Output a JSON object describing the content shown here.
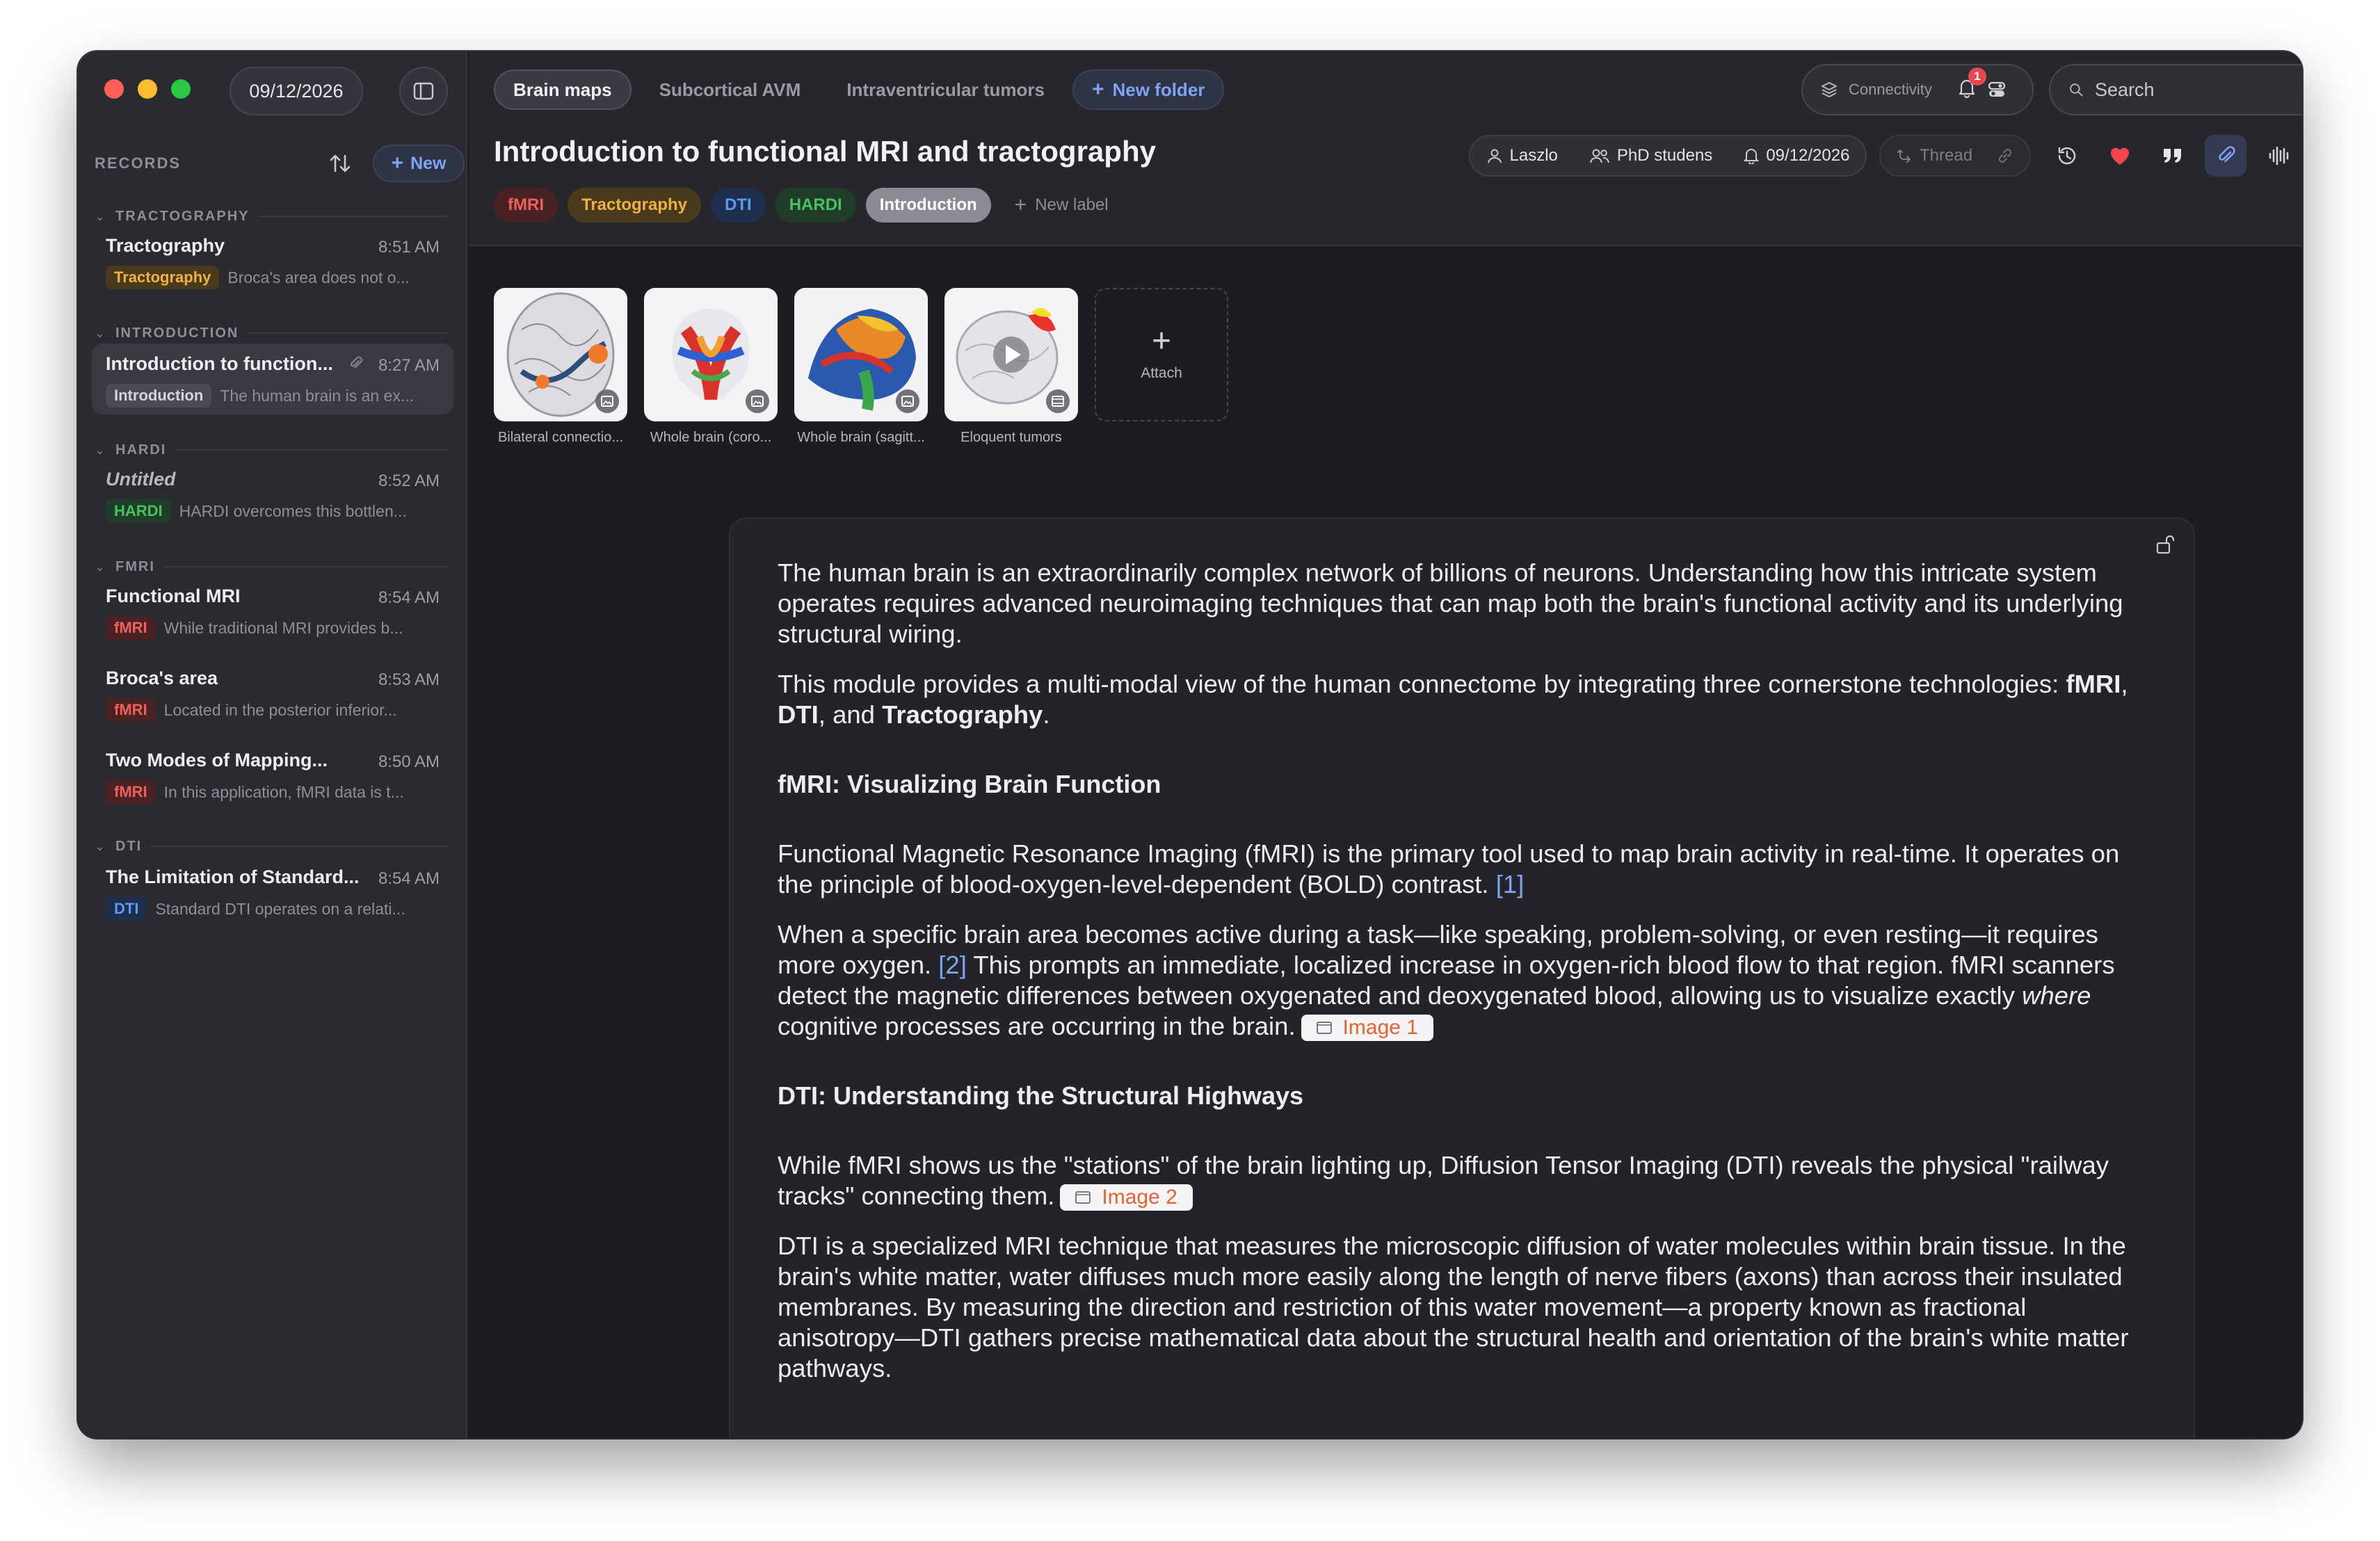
{
  "window": {
    "date": "09/12/2026"
  },
  "sidebar": {
    "title": "RECORDS",
    "new_label": "New",
    "sections": [
      {
        "name": "TRACTOGRAPHY",
        "items": [
          {
            "title": "Tractography",
            "time": "8:51 AM",
            "tag": "Tractography",
            "preview": "Broca's area does not o..."
          }
        ]
      },
      {
        "name": "INTRODUCTION",
        "items": [
          {
            "title": "Introduction to function...",
            "time": "8:27 AM",
            "tag": "Introduction",
            "preview": "The human brain is an ex..."
          }
        ]
      },
      {
        "name": "HARDI",
        "items": [
          {
            "title": "Untitled",
            "time": "8:52 AM",
            "tag": "HARDI",
            "preview": "HARDI overcomes this bottlen..."
          }
        ]
      },
      {
        "name": "FMRI",
        "items": [
          {
            "title": "Functional MRI",
            "time": "8:54 AM",
            "tag": "fMRI",
            "preview": "While traditional MRI provides b..."
          },
          {
            "title": "Broca's area",
            "time": "8:53 AM",
            "tag": "fMRI",
            "preview": "Located in the posterior inferior..."
          },
          {
            "title": "Two Modes of Mapping...",
            "time": "8:50 AM",
            "tag": "fMRI",
            "preview": "In this application, fMRI data is t..."
          }
        ]
      },
      {
        "name": "DTI",
        "items": [
          {
            "title": "The Limitation of Standard...",
            "time": "8:54 AM",
            "tag": "DTI",
            "preview": "Standard DTI operates on a relati..."
          }
        ]
      }
    ]
  },
  "tabs": [
    "Brain maps",
    "Subcortical AVM",
    "Intraventricular tumors",
    "New folder"
  ],
  "header": {
    "connectivity": "Connectivity",
    "notification_count": "1",
    "search_placeholder": "Search"
  },
  "document": {
    "title": "Introduction to functional MRI and tractography",
    "labels": [
      "fMRI",
      "Tractography",
      "DTI",
      "HARDI",
      "Introduction",
      "New label"
    ],
    "author": "Laszlo",
    "group": "PhD studens",
    "reminder_date": "09/12/2026",
    "thread_label": "Thread"
  },
  "attachments": {
    "items": [
      {
        "caption": "Bilateral connectio..."
      },
      {
        "caption": "Whole brain (coro..."
      },
      {
        "caption": "Whole brain (sagitt..."
      },
      {
        "caption": "Eloquent tumors"
      }
    ],
    "attach_label": "Attach"
  },
  "content": {
    "p1": "The human brain is an extraordinarily complex network of billions of neurons. Understanding how this intricate system operates requires advanced neuroimaging techniques that can map both the brain's functional activity and its underlying structural wiring.",
    "p2_a": "This module provides a multi-modal view of the human connectome by integrating three cornerstone technologies: ",
    "p2_b1": "fMRI",
    "p2_sep1": ", ",
    "p2_b2": "DTI",
    "p2_sep2": ", and ",
    "p2_b3": "Tractography",
    "p2_end": ".",
    "h1": "fMRI: Visualizing Brain Function",
    "p3": "Functional Magnetic Resonance Imaging (fMRI) is the primary tool used to map brain activity in real-time. It operates on the principle of blood-oxygen-level-dependent (BOLD) contrast. ",
    "ref1": "[1]",
    "p4_a": "When a specific brain area becomes active during a task—like speaking, problem-solving, or even resting—it requires more oxygen. ",
    "ref2": "[2]",
    "p4_b": " This prompts an immediate, localized increase in oxygen-rich blood flow to that region. fMRI scanners detect the magnetic differences between oxygenated and deoxygenated blood, allowing us to visualize exactly ",
    "p4_em": "where",
    "p4_c": " cognitive processes are occurring in the brain.",
    "image1": "Image 1",
    "h2": "DTI: Understanding the Structural Highways",
    "p5": "While fMRI shows us the \"stations\" of the brain lighting up, Diffusion Tensor Imaging (DTI) reveals the physical \"railway tracks\" connecting them.",
    "image2": "Image 2",
    "p6": "DTI is a specialized MRI technique that measures the microscopic diffusion of water molecules within brain tissue. In the brain's white matter, water diffuses much more easily along the length of nerve fibers (axons) than across their insulated membranes. By measuring the direction and restriction of this water movement—a property known as fractional anisotropy—DTI gathers precise mathematical data about the structural health and orientation of the brain's white matter pathways."
  },
  "colors": {
    "accent": "#7fa2f3",
    "tag_fmri": "#e5534b",
    "tag_tractography": "#e0a43a",
    "tag_dti": "#4d8ef0",
    "tag_hardi": "#3fb950",
    "image_chip_text": "#e6622e"
  }
}
